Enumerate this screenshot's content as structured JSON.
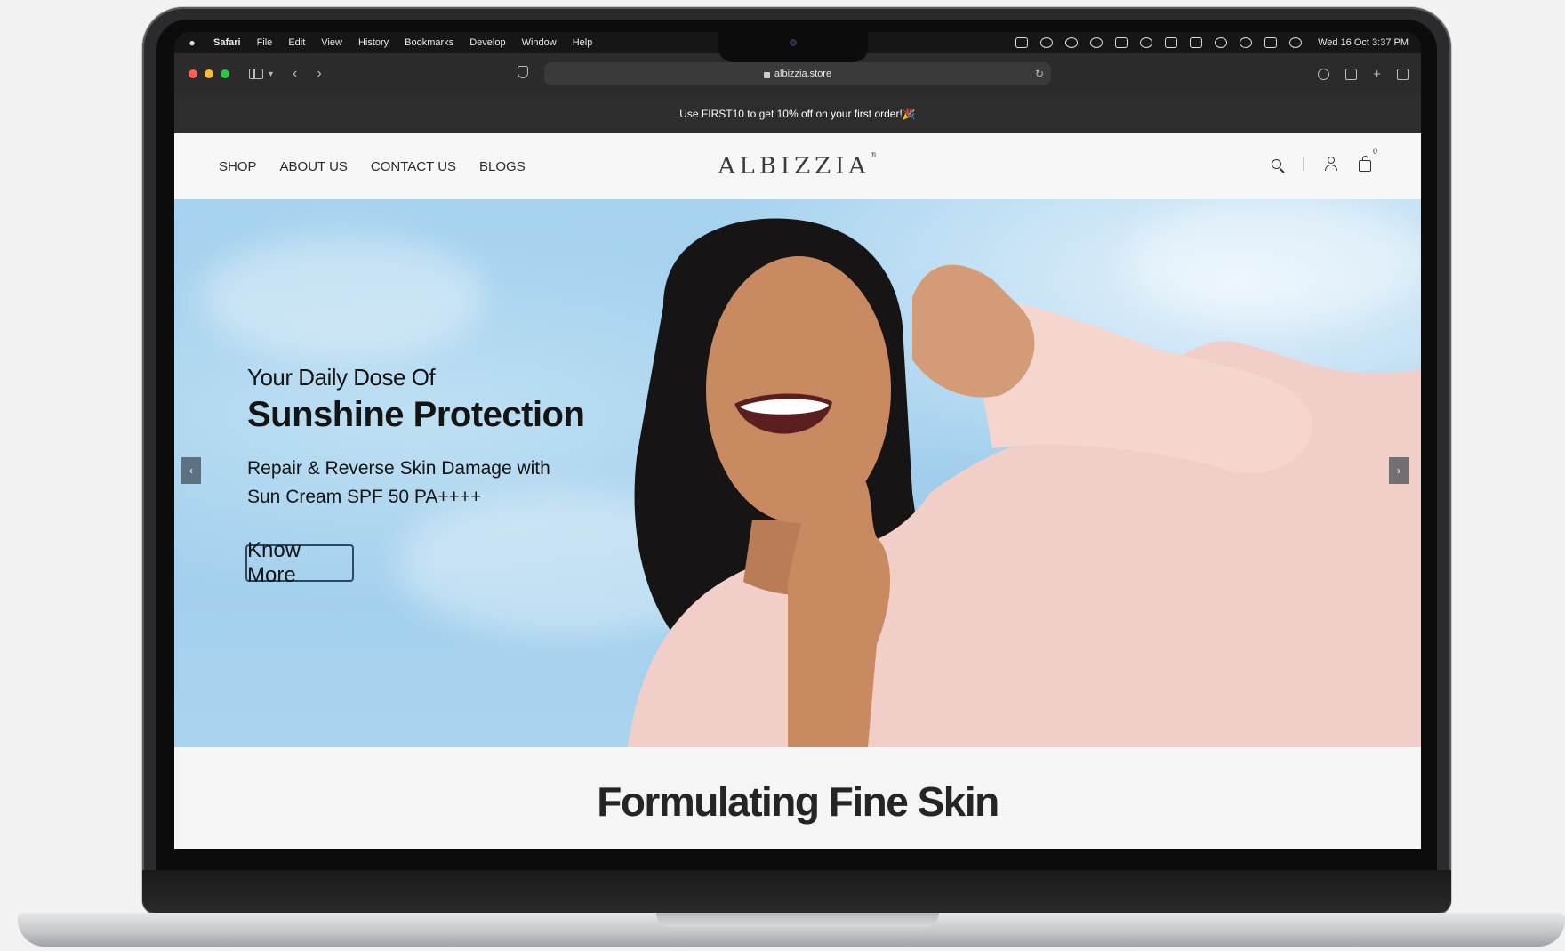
{
  "menubar": {
    "app": "Safari",
    "items": [
      "File",
      "Edit",
      "View",
      "History",
      "Bookmarks",
      "Develop",
      "Window",
      "Help"
    ],
    "clock": "Wed 16 Oct  3:37 PM"
  },
  "browser": {
    "url": "albizzia.store"
  },
  "promo": {
    "text": "Use FIRST10 to get 10% off on your first order!🎉"
  },
  "header": {
    "nav": [
      "SHOP",
      "ABOUT US",
      "CONTACT US",
      "BLOGS"
    ],
    "logo": "ALBIZZIA",
    "logo_mark": "®",
    "cart_count": "0"
  },
  "hero": {
    "line1": "Your Daily Dose Of",
    "line2": "Sunshine Protection",
    "sub1": "Repair & Reverse Skin Damage with",
    "sub2": "Sun Cream SPF 50 PA++++",
    "cta": "Know More",
    "prev": "‹",
    "next": "›"
  },
  "section": {
    "title": "Formulating Fine Skin"
  },
  "colors": {
    "promo_bg": "#2d2d2d",
    "sky": "#a7d3ef",
    "shirt": "#f1cfc8",
    "skin": "#c98a62"
  }
}
